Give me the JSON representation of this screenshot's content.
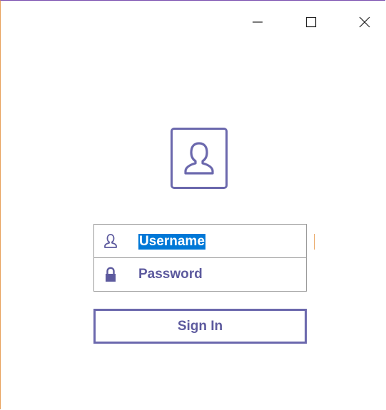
{
  "window": {
    "controls": {
      "minimize_icon": "minimize-icon",
      "maximize_icon": "maximize-icon",
      "close_icon": "close-icon"
    },
    "accent_color": "#6b68ad",
    "text_color": "#5d5a9e",
    "selection_color": "#0078d7"
  },
  "avatar": {
    "icon": "user-icon"
  },
  "login": {
    "username": {
      "icon": "user-icon",
      "value": "Username",
      "selected": true
    },
    "password": {
      "icon": "lock-icon",
      "placeholder": "Password",
      "value": ""
    },
    "signin_label": "Sign In"
  }
}
